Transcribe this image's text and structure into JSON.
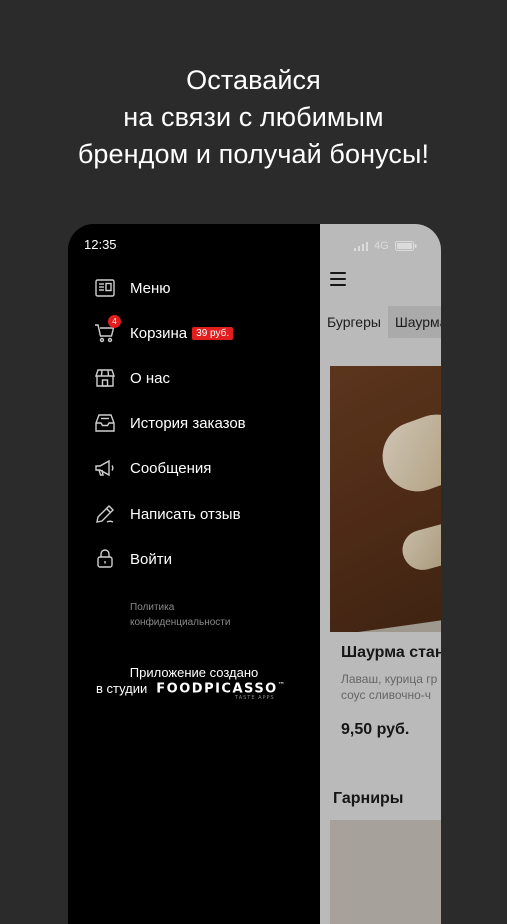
{
  "headline": {
    "line1": "Оставайся",
    "line2": "на связи с любимым",
    "line3": "брендом и получай бонусы!"
  },
  "status": {
    "time": "12:35",
    "network": "4G"
  },
  "drawer": {
    "items": [
      {
        "label": "Меню",
        "icon": "menu-book-icon"
      },
      {
        "label": "Корзина",
        "icon": "cart-icon",
        "badge_count": "4",
        "badge_price": "39 руб."
      },
      {
        "label": "О нас",
        "icon": "store-icon"
      },
      {
        "label": "История заказов",
        "icon": "order-history-icon"
      },
      {
        "label": "Сообщения",
        "icon": "megaphone-icon"
      },
      {
        "label": "Написать отзыв",
        "icon": "edit-pen-icon"
      },
      {
        "label": "Войти",
        "icon": "lock-icon"
      }
    ],
    "privacy_line1": "Политика",
    "privacy_line2": "конфиденциальности",
    "created_by": "Приложение создано",
    "studio_prefix": "в студии",
    "studio_name": "FOODPICASSO",
    "studio_sub": "TASTE APPS"
  },
  "app": {
    "categories": [
      "Бургеры",
      "Шаурма"
    ],
    "product": {
      "title": "Шаурма стан",
      "desc_line1": "Лаваш, курица гр",
      "desc_line2": "соус сливочно-ч",
      "price": "9,50 руб."
    },
    "section_title": "Гарниры"
  },
  "colors": {
    "background": "#2b2b2b",
    "drawer": "#000000",
    "accent_red": "#e11d1d"
  }
}
